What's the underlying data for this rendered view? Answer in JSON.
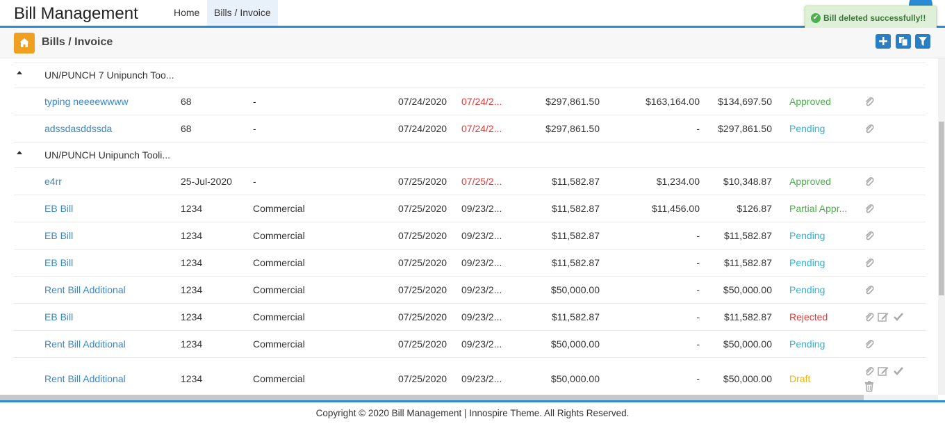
{
  "app": {
    "title": "Bill Management"
  },
  "nav": {
    "tabs": [
      {
        "label": "Home"
      },
      {
        "label": "Bills / Invoice"
      }
    ]
  },
  "toast": {
    "message": "Bill deleted successfully!!",
    "color": "#dff0d8"
  },
  "page": {
    "title": "Bills / Invoice"
  },
  "toolbar": {
    "icons": [
      "plus-icon",
      "copy-icon",
      "filter-icon"
    ]
  },
  "groups": [
    {
      "name": "UN/PUNCH 7 Unipunch Too...",
      "rows": [
        {
          "name": "typing neeeewwww",
          "number": "68",
          "type": "-",
          "date": "07/24/2020",
          "due": "07/24/2...",
          "amount": "$297,861.50",
          "paid": "$163,164.00",
          "balance": "$134,697.50",
          "status": "Approved"
        },
        {
          "name": "adssdasddssda",
          "number": "68",
          "type": "-",
          "date": "07/24/2020",
          "due": "07/24/2...",
          "amount": "$297,861.50",
          "paid": "-",
          "balance": "$297,861.50",
          "status": "Pending"
        }
      ]
    },
    {
      "name": "UN/PUNCH Unipunch Tooli...",
      "rows": [
        {
          "name": "e4rr",
          "number": "25-Jul-2020",
          "type": "-",
          "date": "07/25/2020",
          "due": "07/25/2...",
          "amount": "$11,582.87",
          "paid": "$1,234.00",
          "balance": "$10,348.87",
          "status": "Approved"
        },
        {
          "name": "EB Bill",
          "number": "1234",
          "type": "Commercial",
          "date": "07/25/2020",
          "due": "09/23/2...",
          "amount": "$11,582.87",
          "paid": "$11,456.00",
          "balance": "$126.87",
          "status": "Partial Appr..."
        },
        {
          "name": "EB Bill",
          "number": "1234",
          "type": "Commercial",
          "date": "07/25/2020",
          "due": "09/23/2...",
          "amount": "$11,582.87",
          "paid": "-",
          "balance": "$11,582.87",
          "status": "Pending"
        },
        {
          "name": "EB Bill",
          "number": "1234",
          "type": "Commercial",
          "date": "07/25/2020",
          "due": "09/23/2...",
          "amount": "$11,582.87",
          "paid": "-",
          "balance": "$11,582.87",
          "status": "Pending"
        },
        {
          "name": "Rent Bill Additional",
          "number": "1234",
          "type": "Commercial",
          "date": "07/25/2020",
          "due": "09/23/2...",
          "amount": "$50,000.00",
          "paid": "-",
          "balance": "$50,000.00",
          "status": "Pending"
        },
        {
          "name": "EB Bill",
          "number": "1234",
          "type": "Commercial",
          "date": "07/25/2020",
          "due": "09/23/2...",
          "amount": "$11,582.87",
          "paid": "-",
          "balance": "$11,582.87",
          "status": "Rejected"
        },
        {
          "name": "Rent Bill Additional",
          "number": "1234",
          "type": "Commercial",
          "date": "07/25/2020",
          "due": "09/23/2...",
          "amount": "$50,000.00",
          "paid": "-",
          "balance": "$50,000.00",
          "status": "Pending"
        },
        {
          "name": "Rent Bill Additional",
          "number": "1234",
          "type": "Commercial",
          "date": "07/25/2020",
          "due": "09/23/2...",
          "amount": "$50,000.00",
          "paid": "-",
          "balance": "$50,000.00",
          "status": "Draft"
        }
      ]
    }
  ],
  "footer": {
    "text": "Copyright © 2020 Bill Management | Innospire Theme. All Rights Reserved."
  },
  "colors": {
    "accent": "#2a8ad6",
    "link": "#3a87c8",
    "approved": "#4cae4c",
    "pending": "#2ab4d6",
    "rejected": "#e53935",
    "draft": "#f0b400",
    "home": "#f0a020"
  }
}
